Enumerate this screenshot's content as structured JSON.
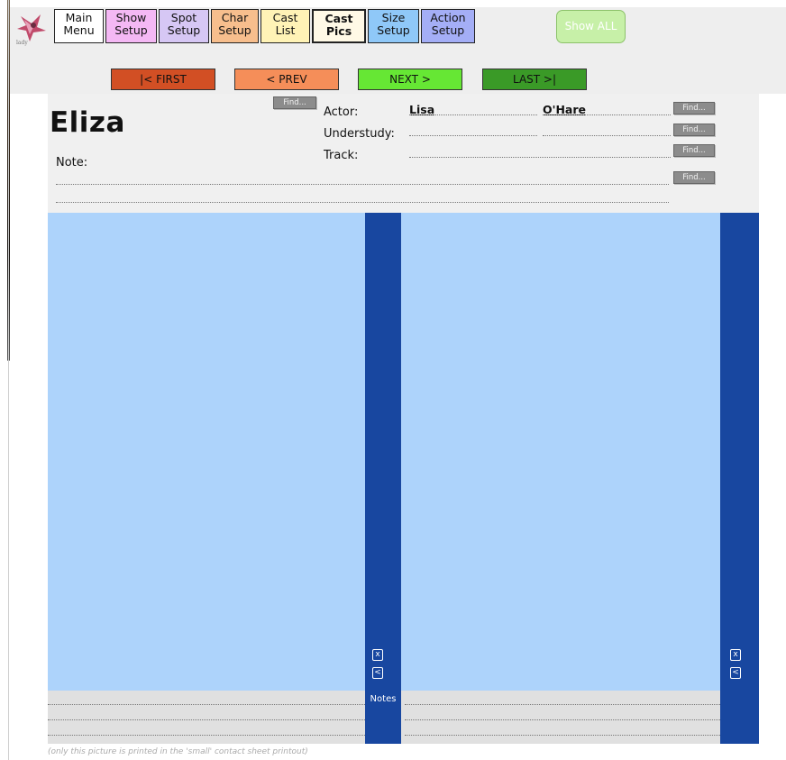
{
  "nav": {
    "buttons": [
      {
        "line1": "Main",
        "line2": "Menu",
        "color": "#ffffff",
        "bold": false
      },
      {
        "line1": "Show",
        "line2": "Setup",
        "color": "#f4b8f4",
        "bold": false
      },
      {
        "line1": "Spot",
        "line2": "Setup",
        "color": "#d6c7f4",
        "bold": false
      },
      {
        "line1": "Char",
        "line2": "Setup",
        "color": "#f7be8d",
        "bold": false
      },
      {
        "line1": "Cast",
        "line2": "List",
        "color": "#fff3b6",
        "bold": false
      },
      {
        "line1": "Cast",
        "line2": "Pics",
        "color": "#fff9e6",
        "bold": true
      },
      {
        "line1": "Size",
        "line2": "Setup",
        "color": "#8fc8f8",
        "bold": false
      },
      {
        "line1": "Action",
        "line2": "Setup",
        "color": "#a4aef6",
        "bold": false
      }
    ],
    "show_all": "Show ALL"
  },
  "pager": {
    "first": {
      "label": "|< FIRST",
      "color": "#d24f24"
    },
    "prev": {
      "label": "< PREV",
      "color": "#f58e59"
    },
    "next": {
      "label": "NEXT >",
      "color": "#66e734"
    },
    "last": {
      "label": "LAST >|",
      "color": "#3a9a27"
    }
  },
  "character": {
    "name": "Eliza",
    "note_label": "Note:",
    "actor_label": "Actor:",
    "understudy_label": "Understudy:",
    "track_label": "Track:",
    "actor_first": "Lisa",
    "actor_last": "O'Hare",
    "find_label": "Find..."
  },
  "photos": {
    "notes_label": "Notes",
    "close_glyph": "x",
    "back_glyph": "<"
  },
  "footer": "(only this picture is printed in the 'small' contact sheet printout)"
}
